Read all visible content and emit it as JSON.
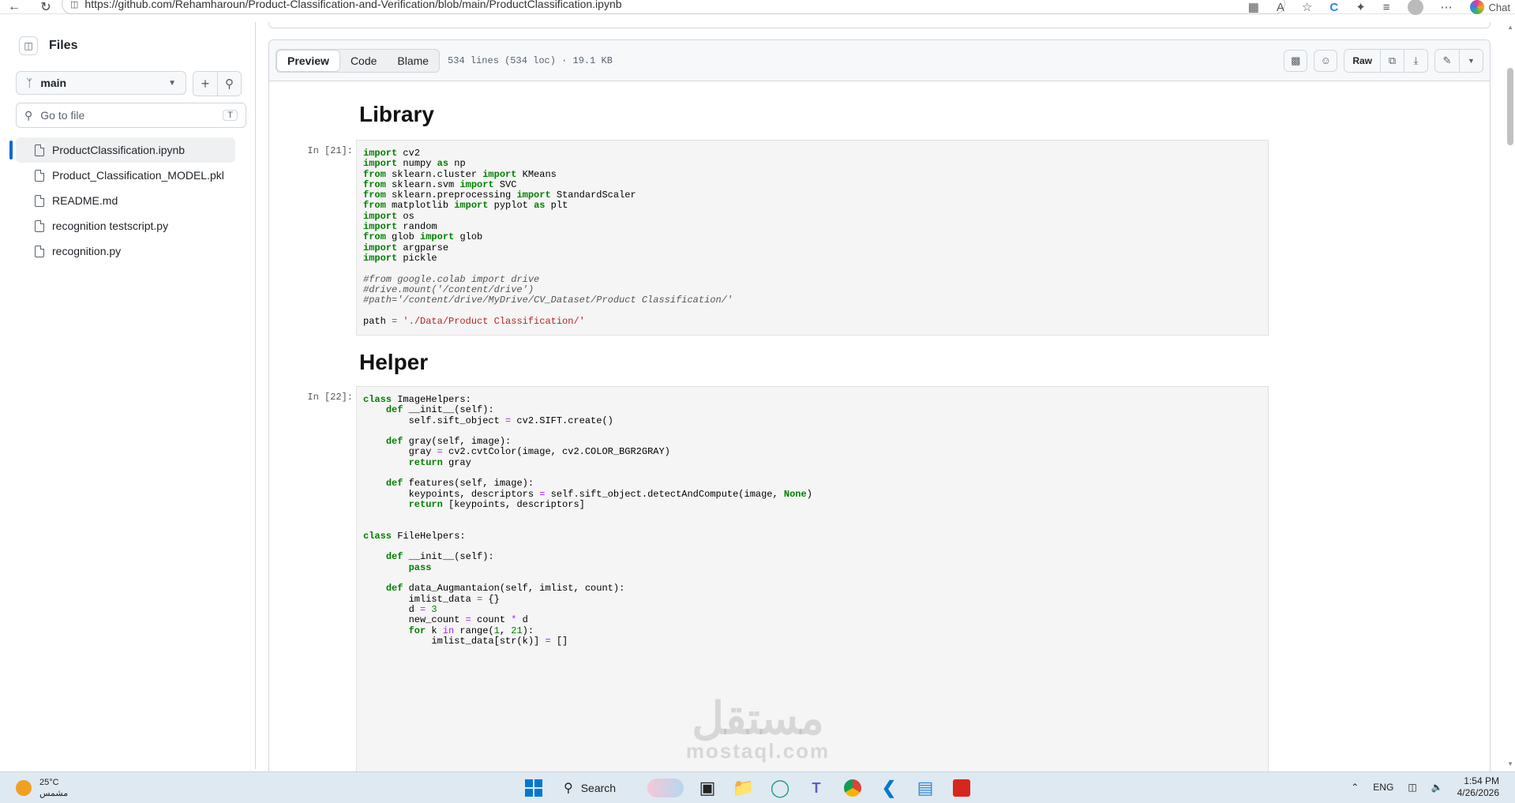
{
  "browser": {
    "url": "https://github.com/Rehamharoun/Product-Classification-and-Verification/blob/main/ProductClassification.ipynb",
    "chat_label": "Chat"
  },
  "sidebar": {
    "title": "Files",
    "branch": "main",
    "goto_placeholder": "Go to file",
    "goto_shortcut": "T",
    "files": [
      "ProductClassification.ipynb",
      "Product_Classification_MODEL.pkl",
      "README.md",
      "recognition testscript.py",
      "recognition.py"
    ]
  },
  "file_header": {
    "tabs": [
      "Preview",
      "Code",
      "Blame"
    ],
    "meta": "534 lines (534 loc) · 19.1 KB",
    "raw_label": "Raw"
  },
  "notebook": {
    "heading1": "Library",
    "prompt1": "In [21]:",
    "heading2": "Helper",
    "prompt2": "In [22]:"
  },
  "watermark": {
    "arabic": "مستقل",
    "latin": "mostaql.com"
  },
  "taskbar": {
    "temperature": "25°C",
    "weather": "مشمس",
    "search_label": "Search",
    "language": "ENG",
    "time": "1:54 PM",
    "date": "4/26/2026"
  },
  "colors": {
    "accent": "#0969da",
    "keyword": "#008000",
    "string": "#ba2121",
    "operator": "#aa22ff"
  }
}
